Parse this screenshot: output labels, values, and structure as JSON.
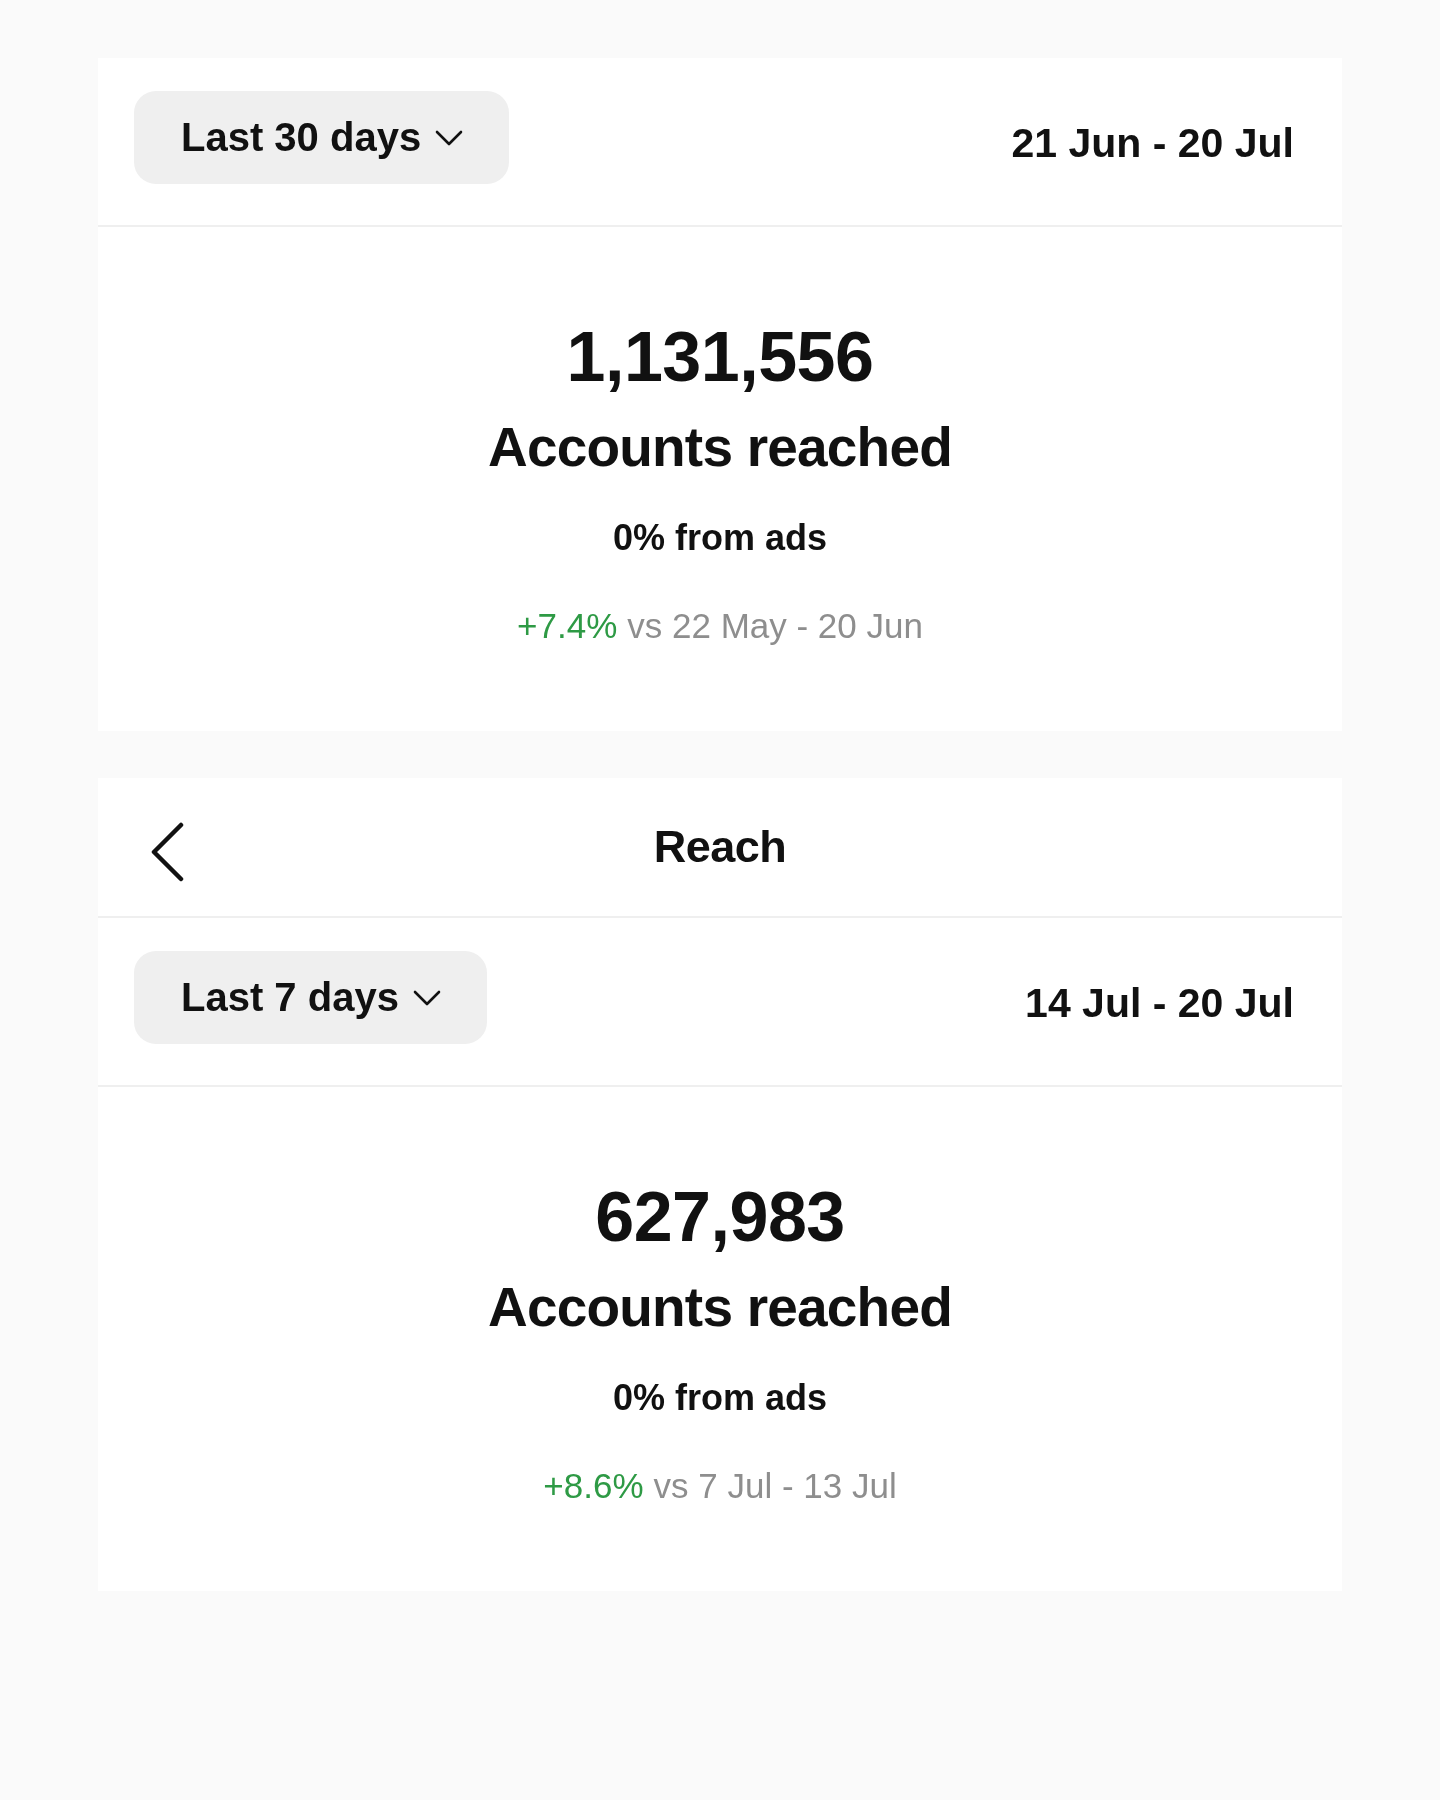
{
  "panels": [
    {
      "filter": {
        "label": "Last 30 days"
      },
      "date_range": "21 Jun - 20 Jul",
      "metric": {
        "value": "1,131,556",
        "label": "Accounts reached",
        "ads_share": "0% from ads",
        "change": "+7.4%",
        "comparison": "vs 22 May - 20 Jun"
      }
    },
    {
      "header": {
        "title": "Reach"
      },
      "filter": {
        "label": "Last 7 days"
      },
      "date_range": "14 Jul - 20 Jul",
      "metric": {
        "value": "627,983",
        "label": "Accounts reached",
        "ads_share": "0% from ads",
        "change": "+8.6%",
        "comparison": "vs 7 Jul - 13 Jul"
      }
    }
  ]
}
